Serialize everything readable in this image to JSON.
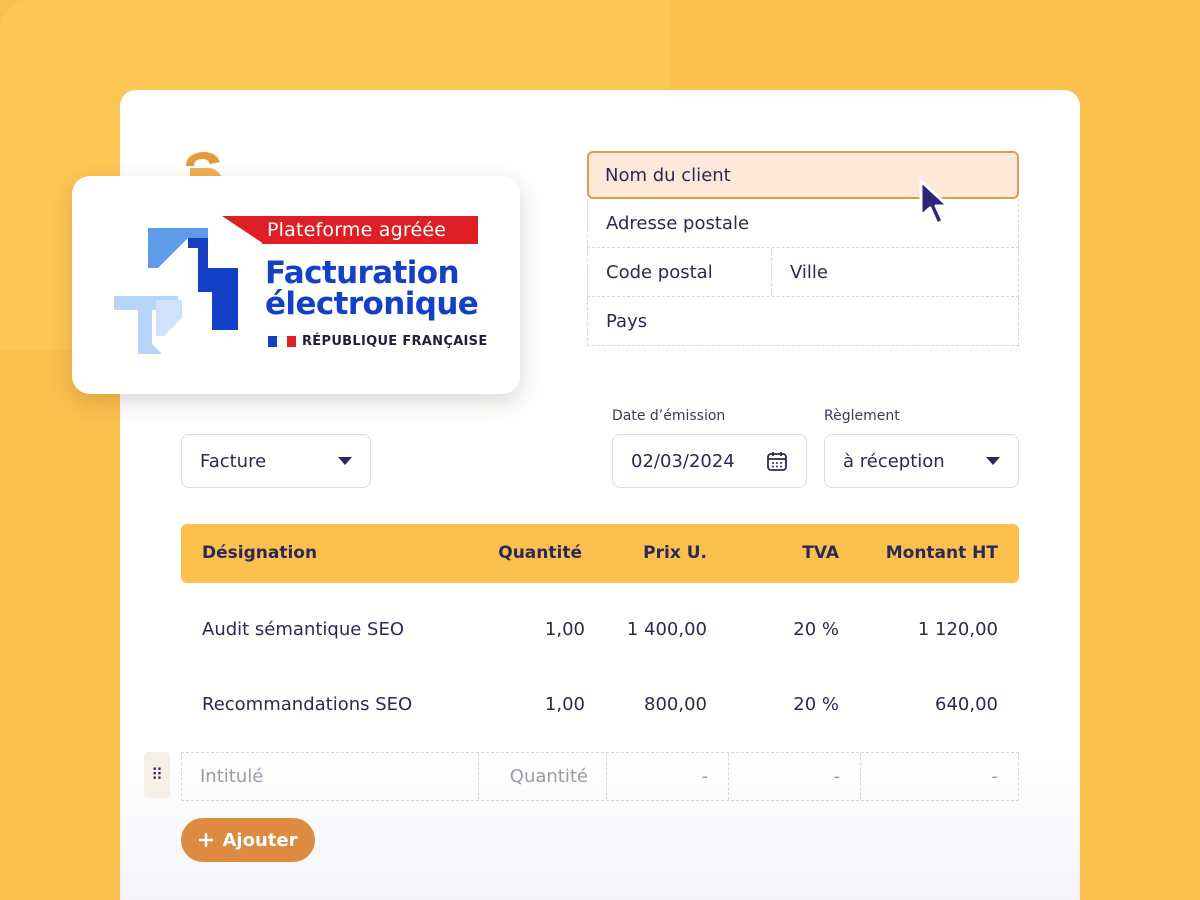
{
  "badge": {
    "ribbon": "Plateforme agréée",
    "title_line1": "Facturation",
    "title_line2": "électronique",
    "republic": "RÉPUBLIQUE FRANÇAISE",
    "colors": {
      "red": "#de1f26",
      "blue": "#1440c8",
      "light_blue": "#7fb1ef"
    }
  },
  "client": {
    "name_placeholder": "Nom du client",
    "address_placeholder": "Adresse postale",
    "postal_code_placeholder": "Code postal",
    "city_placeholder": "Ville",
    "country_placeholder": "Pays"
  },
  "document": {
    "type_value": "Facture",
    "date_label": "Date d’émission",
    "date_value": "02/03/2024",
    "payment_label": "Règlement",
    "payment_value": "à réception"
  },
  "table": {
    "headers": [
      "Désignation",
      "Quantité",
      "Prix U.",
      "TVA",
      "Montant HT"
    ],
    "rows": [
      {
        "designation": "Audit sémantique SEO",
        "quantity": "1,00",
        "unit_price": "1 400,00",
        "vat": "20 %",
        "amount": "1 120,00"
      },
      {
        "designation": "Recommandations SEO",
        "quantity": "1,00",
        "unit_price": "800,00",
        "vat": "20 %",
        "amount": "640,00"
      }
    ],
    "new_row": {
      "label_placeholder": "Intitulé",
      "quantity_placeholder": "Quantité",
      "unit_price": "-",
      "vat": "-",
      "amount": "-"
    }
  },
  "add_button": {
    "label": "Ajouter",
    "icon": "plus-icon"
  },
  "colors": {
    "background": "#fcc04e",
    "header": "#fcc04e",
    "accent": "#dd8b42",
    "text": "#2b2a55",
    "active_field_bg": "#fce9da"
  }
}
